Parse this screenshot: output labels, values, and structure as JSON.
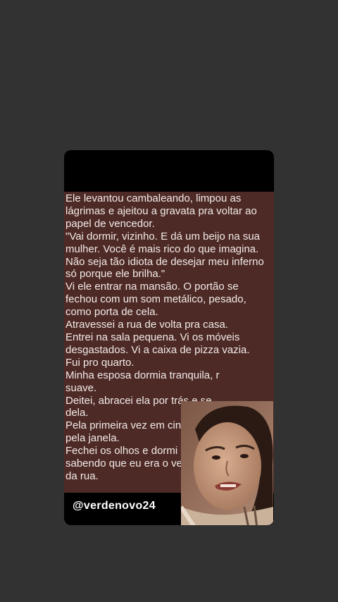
{
  "story": {
    "lines": [
      "Ele levantou cambaleando, limpou as",
      "lágrimas e ajeitou a gravata pra voltar ao",
      "papel de vencedor.",
      "\"Vai dormir, vizinho. E dá um beijo na sua",
      "mulher. Você é mais rico do que imagina.",
      "Não seja tão idiota de desejar meu inferno",
      "só porque ele brilha.\"",
      "Vi ele entrar na mansão. O portão se",
      "fechou com um som metálico, pesado,",
      "como porta de cela.",
      "Atravessei a rua de volta pra casa.",
      "Entrei na sala pequena. Vi os móveis",
      "desgastados. Vi a caixa de pizza vazia.",
      "Fui pro quarto.",
      "Minha esposa dormia tranquila, r",
      "suave.",
      "Deitei, abracei ela por trás e se",
      "dela.",
      "Pela primeira vez em cinco a",
      "pela janela.",
      "Fechei os olhos e dormi c",
      "sabendo que eu era o ve",
      "da rua."
    ]
  },
  "handle": "@verdenovo24",
  "colors": {
    "page_background": "#323232",
    "card_background": "#000000",
    "story_background": "#4e2a27",
    "text": "#f1ebe6"
  }
}
